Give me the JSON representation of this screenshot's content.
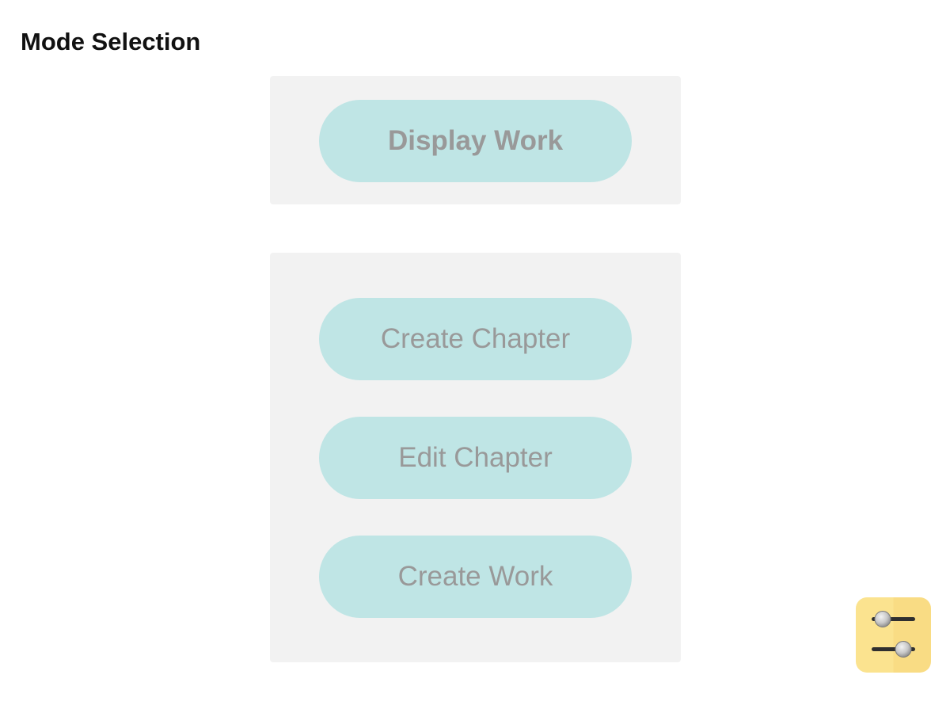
{
  "header": {
    "title": "Mode Selection"
  },
  "display_panel": {
    "display_work_label": "Display Work"
  },
  "edit_panel": {
    "create_chapter_label": "Create Chapter",
    "edit_chapter_label": "Edit Chapter",
    "create_work_label": "Create Work"
  },
  "settings": {
    "icon": "sliders-icon"
  },
  "colors": {
    "panel_background": "#f2f2f2",
    "button_background": "#bfe5e5",
    "button_text": "#999999",
    "settings_background": "#fbe38f"
  }
}
